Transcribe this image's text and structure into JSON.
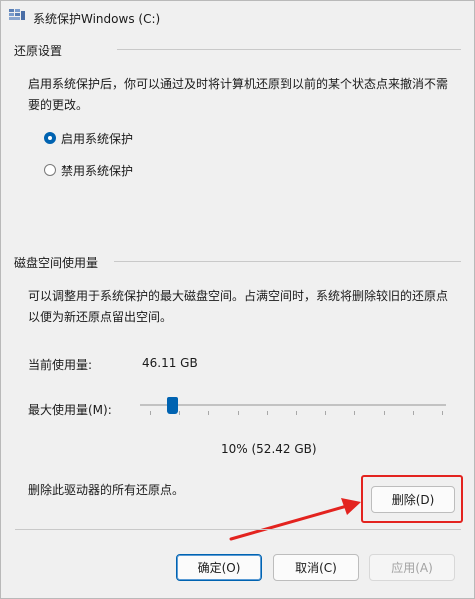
{
  "window": {
    "title": "系统保护Windows (C:)",
    "icon": "system-protection-icon"
  },
  "restore_settings": {
    "heading": "还原设置",
    "description": "启用系统保护后，你可以通过及时将计算机还原到以前的某个状态点来撤消不需要的更改。",
    "options": [
      {
        "label": "启用系统保护",
        "checked": true
      },
      {
        "label": "禁用系统保护",
        "checked": false
      }
    ]
  },
  "disk_usage": {
    "heading": "磁盘空间使用量",
    "description": "可以调整用于系统保护的最大磁盘空间。占满空间时，系统将删除较旧的还原点以便为新还原点留出空间。",
    "current_label": "当前使用量:",
    "current_value": "46.11 GB",
    "max_label": "最大使用量(M):",
    "slider_percent": 10,
    "slider_caption": "10% (52.42 GB)"
  },
  "delete_section": {
    "text": "删除此驱动器的所有还原点。",
    "button_label": "删除(D)"
  },
  "footer": {
    "ok_label": "确定(O)",
    "cancel_label": "取消(C)",
    "apply_label": "应用(A)"
  },
  "colors": {
    "accent": "#0063b1",
    "annotation": "#e3231f"
  }
}
